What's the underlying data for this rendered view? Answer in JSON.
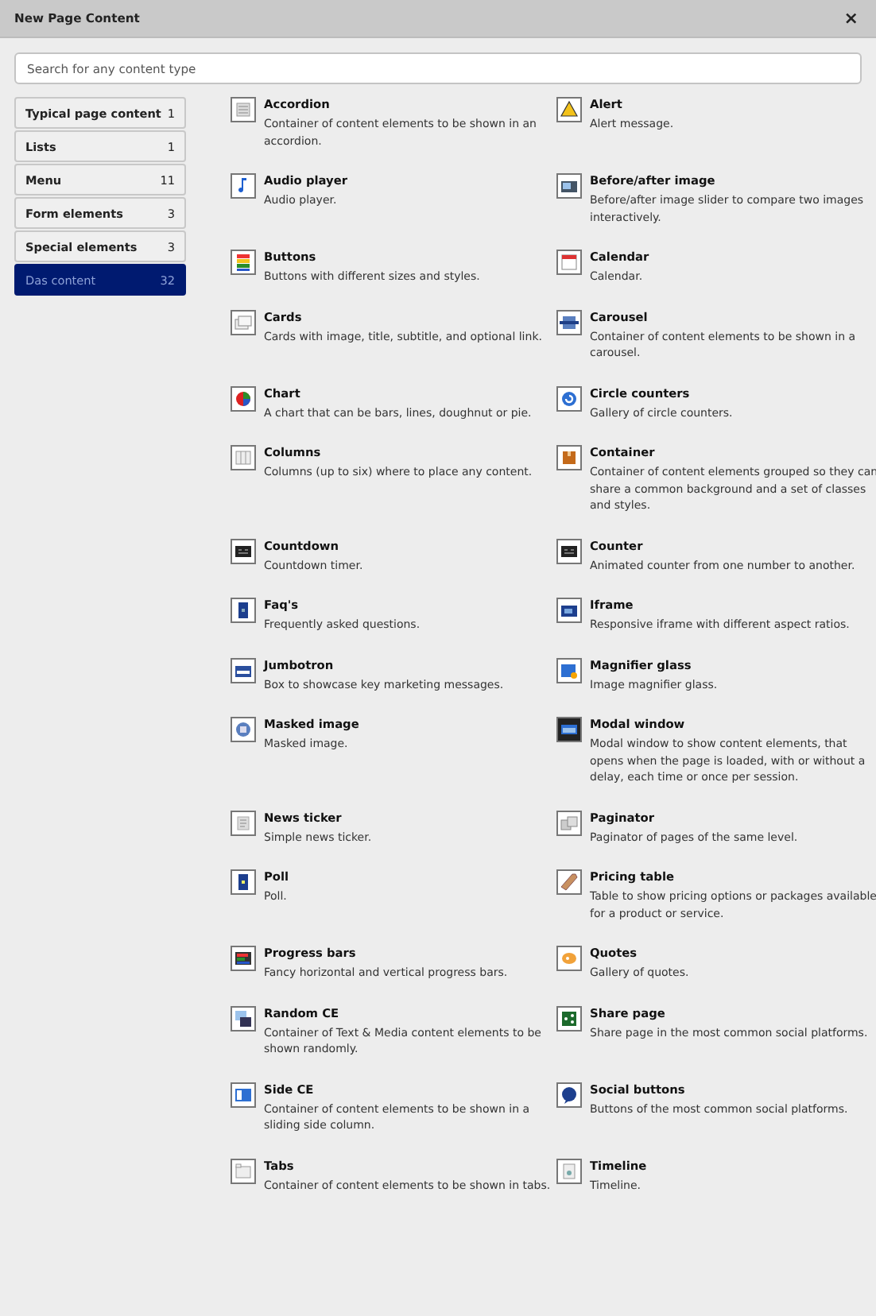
{
  "dialog": {
    "title": "New Page Content",
    "close": "×"
  },
  "search": {
    "placeholder": "Search for any content type"
  },
  "categories": [
    {
      "label": "Typical page content",
      "count": "1",
      "selected": false
    },
    {
      "label": "Lists",
      "count": "1",
      "selected": false
    },
    {
      "label": "Menu",
      "count": "11",
      "selected": false
    },
    {
      "label": "Form elements",
      "count": "3",
      "selected": false
    },
    {
      "label": "Special elements",
      "count": "3",
      "selected": false
    },
    {
      "label": "Das content",
      "count": "32",
      "selected": true
    }
  ],
  "content_types": [
    {
      "title": "Accordion",
      "description": "Container of content elements to be shown in an accordion."
    },
    {
      "title": "Alert",
      "description": "Alert message."
    },
    {
      "title": "Audio player",
      "description": "Audio player."
    },
    {
      "title": "Before/after image",
      "description": "Before/after image slider to compare two images interactively."
    },
    {
      "title": "Buttons",
      "description": "Buttons with different sizes and styles."
    },
    {
      "title": "Calendar",
      "description": "Calendar."
    },
    {
      "title": "Cards",
      "description": "Cards with image, title, subtitle, and optional link."
    },
    {
      "title": "Carousel",
      "description": "Container of content elements to be shown in a carousel."
    },
    {
      "title": "Chart",
      "description": "A chart that can be bars, lines, doughnut or pie."
    },
    {
      "title": "Circle counters",
      "description": "Gallery of circle counters."
    },
    {
      "title": "Columns",
      "description": "Columns (up to six) where to place any content."
    },
    {
      "title": "Container",
      "description": "Container of content elements grouped so they can share a common background and a set of classes and styles."
    },
    {
      "title": "Countdown",
      "description": "Countdown timer."
    },
    {
      "title": "Counter",
      "description": "Animated counter from one number to another."
    },
    {
      "title": "Faq's",
      "description": "Frequently asked questions."
    },
    {
      "title": "Iframe",
      "description": "Responsive iframe with different aspect ratios."
    },
    {
      "title": "Jumbotron",
      "description": "Box to showcase key marketing messages."
    },
    {
      "title": "Magnifier glass",
      "description": "Image magnifier glass."
    },
    {
      "title": "Masked image",
      "description": "Masked image."
    },
    {
      "title": "Modal window",
      "description": "Modal window to show content elements, that opens when the page is loaded, with or without a delay, each time or once per session."
    },
    {
      "title": "News ticker",
      "description": "Simple news ticker."
    },
    {
      "title": "Paginator",
      "description": "Paginator of pages of the same level."
    },
    {
      "title": "Poll",
      "description": "Poll."
    },
    {
      "title": "Pricing table",
      "description": "Table to show pricing options or packages available for a product or service."
    },
    {
      "title": "Progress bars",
      "description": "Fancy horizontal and vertical progress bars."
    },
    {
      "title": "Quotes",
      "description": "Gallery of quotes."
    },
    {
      "title": "Random CE",
      "description": "Container of Text & Media content elements to be shown randomly."
    },
    {
      "title": "Share page",
      "description": "Share page in the most common social platforms."
    },
    {
      "title": "Side CE",
      "description": "Container of content elements to be shown in a sliding side column."
    },
    {
      "title": "Social buttons",
      "description": "Buttons of the most common social platforms."
    },
    {
      "title": "Tabs",
      "description": "Container of content elements to be shown in tabs."
    },
    {
      "title": "Timeline",
      "description": "Timeline."
    }
  ]
}
